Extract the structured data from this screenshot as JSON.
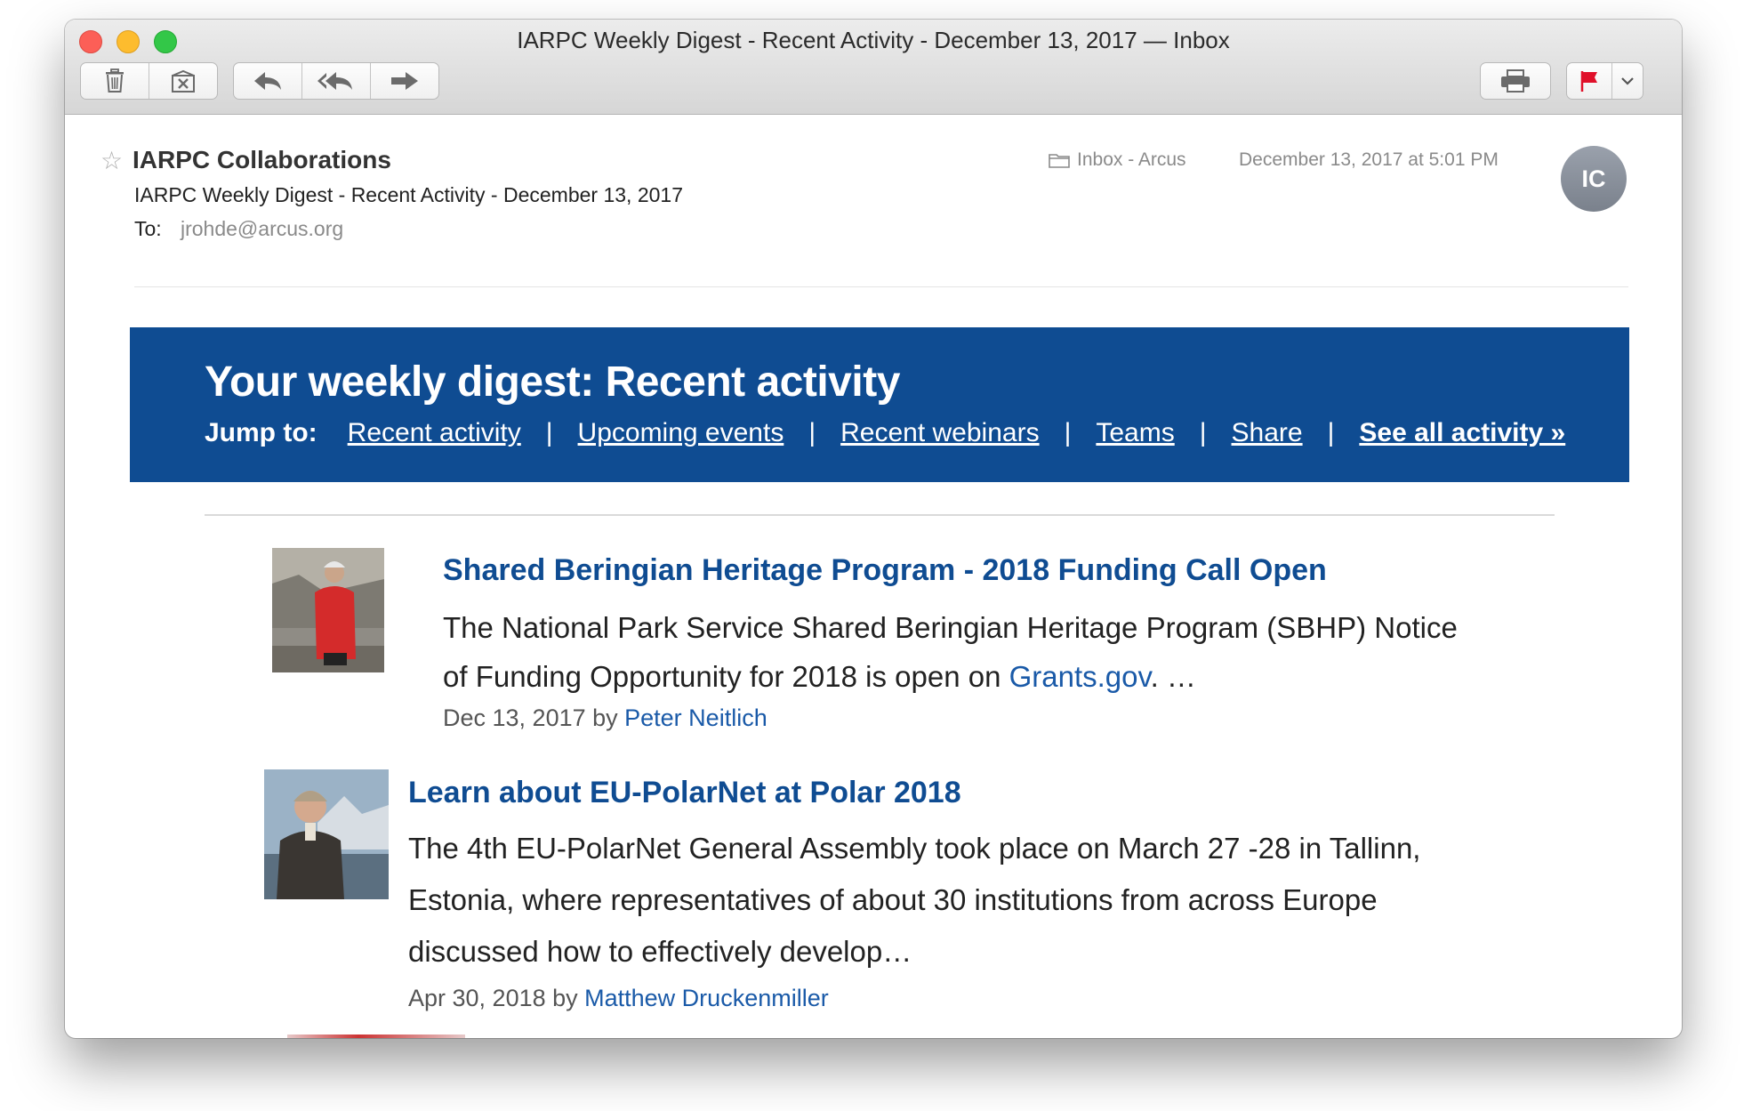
{
  "window": {
    "title": "IARPC Weekly Digest - Recent Activity - December 13, 2017 — Inbox"
  },
  "message": {
    "from": "IARPC Collaborations",
    "subject": "IARPC Weekly Digest - Recent Activity - December 13, 2017",
    "to_label": "To:",
    "to": "jrohde@arcus.org",
    "mailbox": "Inbox - Arcus",
    "date": "December 13, 2017 at 5:01 PM",
    "avatar_initials": "IC"
  },
  "banner": {
    "title": "Your weekly digest: Recent activity",
    "jump_label": "Jump to:",
    "separator": "|",
    "links": [
      "Recent activity",
      "Upcoming events",
      "Recent webinars",
      "Teams",
      "Share",
      "See all activity »"
    ],
    "color": "#0f4c92"
  },
  "items": [
    {
      "title": "Shared Beringian Heritage Program - 2018 Funding Call Open",
      "body_line1": "The National Park Service Shared Beringian Heritage Program (SBHP) Notice",
      "body_line2_prefix": "of Funding Opportunity for 2018 is open on ",
      "body_link": "Grants.gov",
      "body_line2_suffix": ". …",
      "meta_date": "Dec 13, 2017 by ",
      "author": "Peter Neitlich"
    },
    {
      "title": "Learn about EU-PolarNet at Polar 2018",
      "body_line1": "The 4th EU-PolarNet General Assembly took place on March 27 -28 in Tallinn,",
      "body_line2": "Estonia, where representatives of about 30 institutions from across Europe",
      "body_line3": "discussed how to effectively develop…",
      "meta_date": "Apr 30, 2018 by ",
      "author": "Matthew Druckenmiller"
    }
  ],
  "toolbar": {
    "icons": [
      "trash-icon",
      "junk-icon",
      "reply-icon",
      "reply-all-icon",
      "forward-icon",
      "print-icon",
      "flag-icon",
      "chevron-down-icon"
    ]
  },
  "colors": {
    "link": "#1a5aa8",
    "title_blue": "#0f4c92",
    "flag": "#e0102a"
  }
}
